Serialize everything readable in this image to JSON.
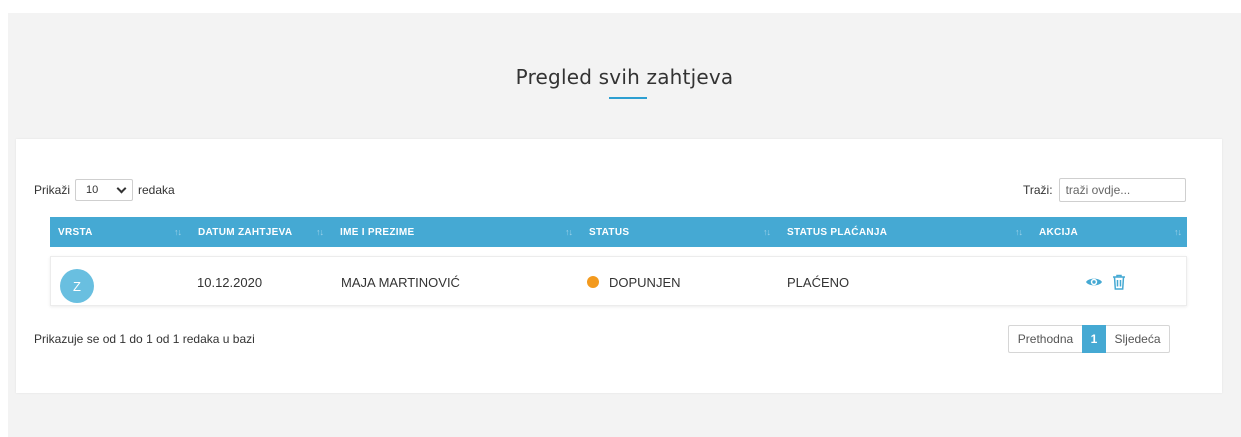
{
  "header": {
    "title": "Pregled svih zahtjeva"
  },
  "controls": {
    "show_label": "Prikaži",
    "page_length": "10",
    "rows_label": "redaka",
    "search_label": "Traži:",
    "search_placeholder": "traži ovdje..."
  },
  "table": {
    "columns": [
      "VRSTA",
      "DATUM ZAHTJEVA",
      "IME I PREZIME",
      "STATUS",
      "STATUS PLAĆANJA",
      "AKCIJA"
    ],
    "rows": [
      {
        "avatar_letter": "Z",
        "date": "10.12.2020",
        "name": "MAJA MARTINOVIĆ",
        "status": "DOPUNJEN",
        "status_color": "#f39a1e",
        "payment_status": "PLAĆENO",
        "actions": [
          "eye-icon",
          "trash-icon"
        ]
      }
    ]
  },
  "footer": {
    "info": "Prikazuje se od 1 do 1 od 1 redaka u bazi",
    "pagination": {
      "previous": "Prethodna",
      "current": "1",
      "next": "Sljedeća"
    }
  },
  "colors": {
    "accent": "#45a9d3",
    "title_underline": "#2d9fd1",
    "avatar": "#69bfe0"
  }
}
